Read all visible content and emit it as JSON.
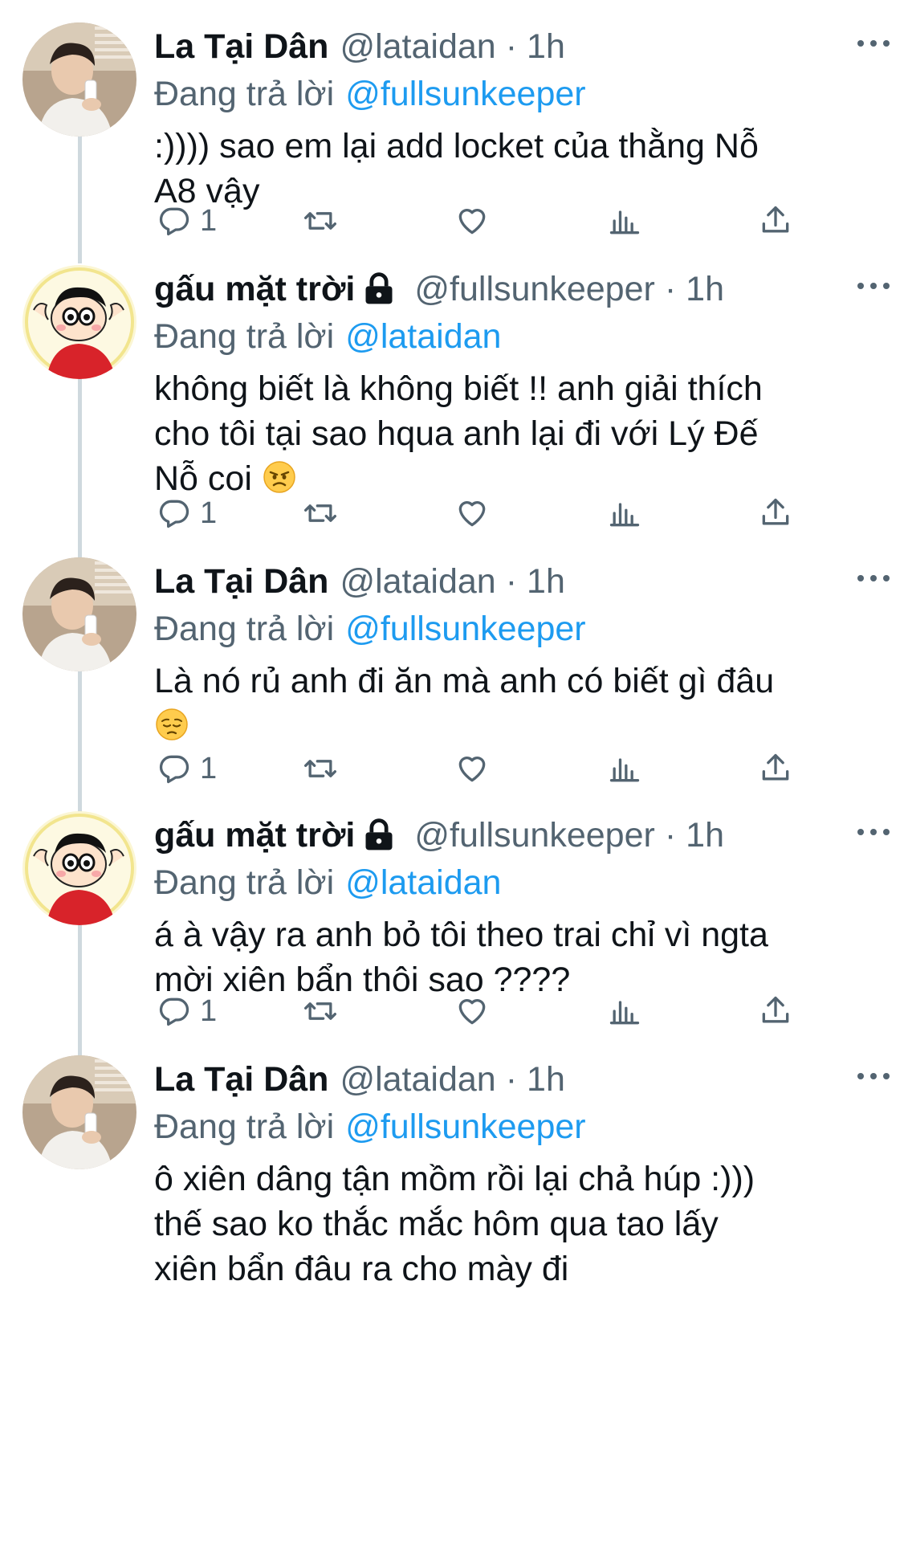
{
  "users": {
    "la": {
      "display_name": "La Tại Dân",
      "handle": "@lataidan",
      "locked": false
    },
    "gau": {
      "display_name": "gấu mặt trời",
      "handle": "@fullsunkeeper",
      "locked": true
    }
  },
  "tweets": [
    {
      "display_name": "La Tại Dân",
      "handle": "@lataidan",
      "dot": "·",
      "time": "1h",
      "reply_prefix": "Đang trả lời",
      "reply_to": "@fullsunkeeper",
      "text": ":)))) sao em lại add locket của thằng Nỗ\nA8 vậy",
      "emoji": "",
      "reply_count": "1"
    },
    {
      "display_name": "gấu mặt trời",
      "handle": "@fullsunkeeper",
      "dot": "·",
      "time": "1h",
      "reply_prefix": "Đang trả lời",
      "reply_to": "@lataidan",
      "text": "không biết là không biết !! anh giải thích\ncho tôi tại sao hqua anh lại đi với Lý Đế\nNỗ coi ",
      "emoji": "angry-face",
      "reply_count": "1"
    },
    {
      "display_name": "La Tại Dân",
      "handle": "@lataidan",
      "dot": "·",
      "time": "1h",
      "reply_prefix": "Đang trả lời",
      "reply_to": "@fullsunkeeper",
      "text": "Là nó rủ anh đi ăn mà anh có biết gì đâu\n",
      "emoji": "pensive-face",
      "reply_count": "1"
    },
    {
      "display_name": "gấu mặt trời",
      "handle": "@fullsunkeeper",
      "dot": "·",
      "time": "1h",
      "reply_prefix": "Đang trả lời",
      "reply_to": "@lataidan",
      "text": "á à vậy ra anh bỏ tôi theo trai chỉ vì ngta\nmời xiên bẩn thôi sao ????",
      "emoji": "",
      "reply_count": "1"
    },
    {
      "display_name": "La Tại Dân",
      "handle": "@lataidan",
      "dot": "·",
      "time": "1h",
      "reply_prefix": "Đang trả lời",
      "reply_to": "@fullsunkeeper",
      "text": "ô xiên dâng tận mồm rồi lại chả húp :)))\nthế sao ko thắc mắc hôm qua tao lấy\nxiên bẩn đâu ra cho mày đi",
      "emoji": "",
      "reply_count": ""
    }
  ],
  "icons": {
    "more": "more-horizontal-icon",
    "reply": "reply-icon",
    "retweet": "retweet-icon",
    "like": "heart-icon",
    "views": "analytics-icon",
    "share": "share-icon",
    "lock": "lock-icon"
  },
  "colors": {
    "text": "#0f1419",
    "secondary": "#536471",
    "link": "#1d9bf0",
    "thread_line": "#cfd9de"
  }
}
